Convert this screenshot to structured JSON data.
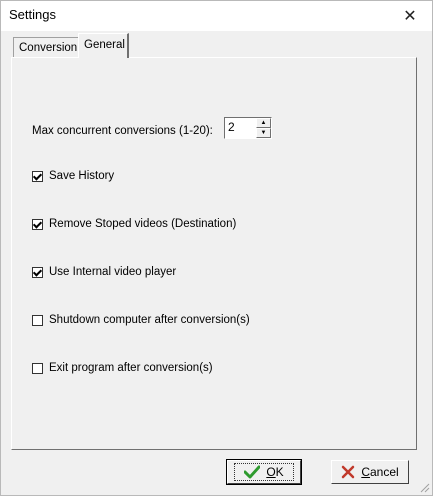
{
  "window": {
    "title": "Settings",
    "close_glyph": "✕"
  },
  "tabs": [
    {
      "label": "Conversion",
      "selected": false
    },
    {
      "label": "General",
      "selected": true
    }
  ],
  "general": {
    "max_concurrent_label": "Max concurrent conversions (1-20):",
    "max_concurrent_value": "2",
    "spin_up_glyph": "▲",
    "spin_down_glyph": "▼",
    "options": [
      {
        "label": "Save History",
        "checked": true
      },
      {
        "label": "Remove Stoped videos (Destination)",
        "checked": true
      },
      {
        "label": "Use Internal video player",
        "checked": true
      },
      {
        "label": "Shutdown computer after conversion(s)",
        "checked": false
      },
      {
        "label": "Exit program after conversion(s)",
        "checked": false
      }
    ]
  },
  "buttons": {
    "ok_label": "OK",
    "cancel_label": "Cancel"
  },
  "colors": {
    "ok_check": "#2e9b2e",
    "cancel_x": "#c0392b"
  },
  "icons": {
    "ok": "checkmark-icon",
    "cancel": "cross-icon"
  }
}
